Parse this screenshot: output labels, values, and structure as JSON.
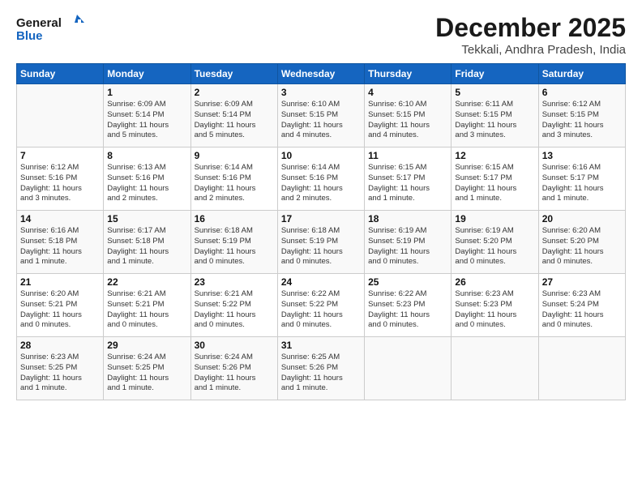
{
  "header": {
    "logo_line1": "General",
    "logo_line2": "Blue",
    "month_title": "December 2025",
    "location": "Tekkali, Andhra Pradesh, India"
  },
  "weekdays": [
    "Sunday",
    "Monday",
    "Tuesday",
    "Wednesday",
    "Thursday",
    "Friday",
    "Saturday"
  ],
  "weeks": [
    [
      {
        "day": "",
        "info": ""
      },
      {
        "day": "1",
        "info": "Sunrise: 6:09 AM\nSunset: 5:14 PM\nDaylight: 11 hours\nand 5 minutes."
      },
      {
        "day": "2",
        "info": "Sunrise: 6:09 AM\nSunset: 5:14 PM\nDaylight: 11 hours\nand 5 minutes."
      },
      {
        "day": "3",
        "info": "Sunrise: 6:10 AM\nSunset: 5:15 PM\nDaylight: 11 hours\nand 4 minutes."
      },
      {
        "day": "4",
        "info": "Sunrise: 6:10 AM\nSunset: 5:15 PM\nDaylight: 11 hours\nand 4 minutes."
      },
      {
        "day": "5",
        "info": "Sunrise: 6:11 AM\nSunset: 5:15 PM\nDaylight: 11 hours\nand 3 minutes."
      },
      {
        "day": "6",
        "info": "Sunrise: 6:12 AM\nSunset: 5:15 PM\nDaylight: 11 hours\nand 3 minutes."
      }
    ],
    [
      {
        "day": "7",
        "info": "Sunrise: 6:12 AM\nSunset: 5:16 PM\nDaylight: 11 hours\nand 3 minutes."
      },
      {
        "day": "8",
        "info": "Sunrise: 6:13 AM\nSunset: 5:16 PM\nDaylight: 11 hours\nand 2 minutes."
      },
      {
        "day": "9",
        "info": "Sunrise: 6:14 AM\nSunset: 5:16 PM\nDaylight: 11 hours\nand 2 minutes."
      },
      {
        "day": "10",
        "info": "Sunrise: 6:14 AM\nSunset: 5:16 PM\nDaylight: 11 hours\nand 2 minutes."
      },
      {
        "day": "11",
        "info": "Sunrise: 6:15 AM\nSunset: 5:17 PM\nDaylight: 11 hours\nand 1 minute."
      },
      {
        "day": "12",
        "info": "Sunrise: 6:15 AM\nSunset: 5:17 PM\nDaylight: 11 hours\nand 1 minute."
      },
      {
        "day": "13",
        "info": "Sunrise: 6:16 AM\nSunset: 5:17 PM\nDaylight: 11 hours\nand 1 minute."
      }
    ],
    [
      {
        "day": "14",
        "info": "Sunrise: 6:16 AM\nSunset: 5:18 PM\nDaylight: 11 hours\nand 1 minute."
      },
      {
        "day": "15",
        "info": "Sunrise: 6:17 AM\nSunset: 5:18 PM\nDaylight: 11 hours\nand 1 minute."
      },
      {
        "day": "16",
        "info": "Sunrise: 6:18 AM\nSunset: 5:19 PM\nDaylight: 11 hours\nand 0 minutes."
      },
      {
        "day": "17",
        "info": "Sunrise: 6:18 AM\nSunset: 5:19 PM\nDaylight: 11 hours\nand 0 minutes."
      },
      {
        "day": "18",
        "info": "Sunrise: 6:19 AM\nSunset: 5:19 PM\nDaylight: 11 hours\nand 0 minutes."
      },
      {
        "day": "19",
        "info": "Sunrise: 6:19 AM\nSunset: 5:20 PM\nDaylight: 11 hours\nand 0 minutes."
      },
      {
        "day": "20",
        "info": "Sunrise: 6:20 AM\nSunset: 5:20 PM\nDaylight: 11 hours\nand 0 minutes."
      }
    ],
    [
      {
        "day": "21",
        "info": "Sunrise: 6:20 AM\nSunset: 5:21 PM\nDaylight: 11 hours\nand 0 minutes."
      },
      {
        "day": "22",
        "info": "Sunrise: 6:21 AM\nSunset: 5:21 PM\nDaylight: 11 hours\nand 0 minutes."
      },
      {
        "day": "23",
        "info": "Sunrise: 6:21 AM\nSunset: 5:22 PM\nDaylight: 11 hours\nand 0 minutes."
      },
      {
        "day": "24",
        "info": "Sunrise: 6:22 AM\nSunset: 5:22 PM\nDaylight: 11 hours\nand 0 minutes."
      },
      {
        "day": "25",
        "info": "Sunrise: 6:22 AM\nSunset: 5:23 PM\nDaylight: 11 hours\nand 0 minutes."
      },
      {
        "day": "26",
        "info": "Sunrise: 6:23 AM\nSunset: 5:23 PM\nDaylight: 11 hours\nand 0 minutes."
      },
      {
        "day": "27",
        "info": "Sunrise: 6:23 AM\nSunset: 5:24 PM\nDaylight: 11 hours\nand 0 minutes."
      }
    ],
    [
      {
        "day": "28",
        "info": "Sunrise: 6:23 AM\nSunset: 5:25 PM\nDaylight: 11 hours\nand 1 minute."
      },
      {
        "day": "29",
        "info": "Sunrise: 6:24 AM\nSunset: 5:25 PM\nDaylight: 11 hours\nand 1 minute."
      },
      {
        "day": "30",
        "info": "Sunrise: 6:24 AM\nSunset: 5:26 PM\nDaylight: 11 hours\nand 1 minute."
      },
      {
        "day": "31",
        "info": "Sunrise: 6:25 AM\nSunset: 5:26 PM\nDaylight: 11 hours\nand 1 minute."
      },
      {
        "day": "",
        "info": ""
      },
      {
        "day": "",
        "info": ""
      },
      {
        "day": "",
        "info": ""
      }
    ]
  ]
}
